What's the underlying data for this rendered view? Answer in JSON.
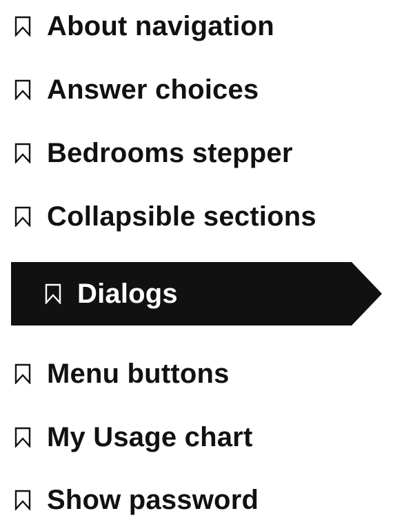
{
  "nav": {
    "items": [
      {
        "label": "About navigation",
        "icon": "bookmark-icon",
        "active": false
      },
      {
        "label": "Answer choices",
        "icon": "bookmark-icon",
        "active": false
      },
      {
        "label": "Bedrooms stepper",
        "icon": "bookmark-icon",
        "active": false
      },
      {
        "label": "Collapsible sections",
        "icon": "bookmark-icon",
        "active": false
      },
      {
        "label": "Dialogs",
        "icon": "bookmark-icon",
        "active": true
      },
      {
        "label": "Menu buttons",
        "icon": "bookmark-icon",
        "active": false
      },
      {
        "label": "My Usage chart",
        "icon": "bookmark-icon",
        "active": false
      },
      {
        "label": "Show password",
        "icon": "bookmark-icon",
        "active": false
      }
    ]
  },
  "colors": {
    "text": "#111111",
    "active_background": "#111111",
    "active_text": "#ffffff",
    "page_background": "#ffffff"
  }
}
